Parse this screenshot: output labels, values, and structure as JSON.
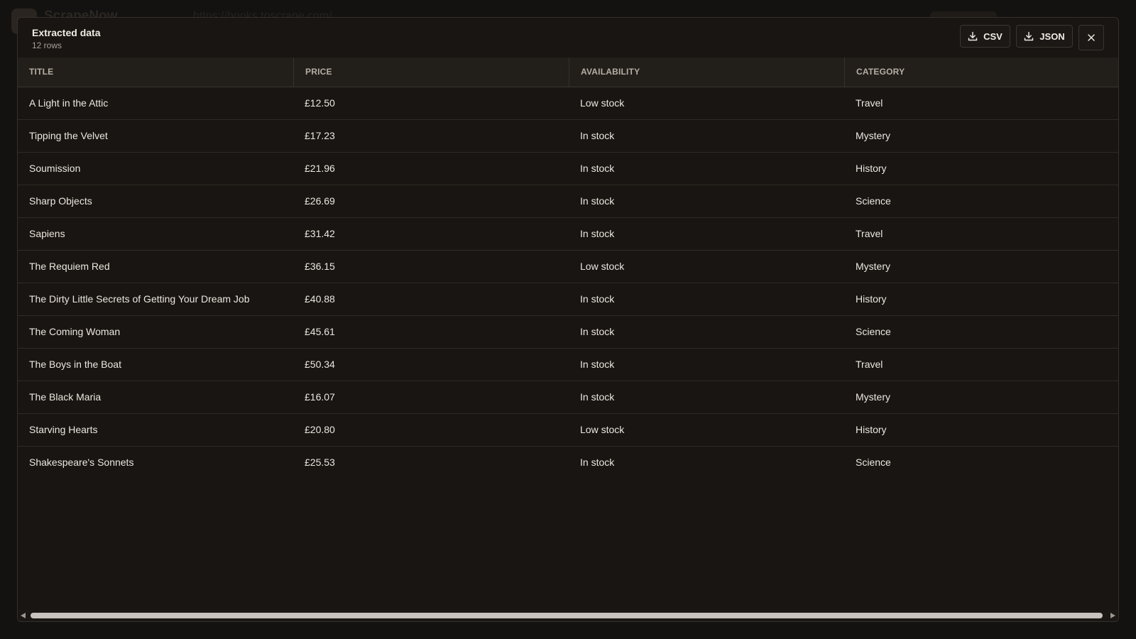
{
  "background": {
    "app_name": "ScrapeNow",
    "url": "https://books.toscrape.com/"
  },
  "modal": {
    "title": "Extracted data",
    "subtitle": "12 rows",
    "csv_label": "CSV",
    "json_label": "JSON",
    "close_icon": "close-icon",
    "download_icon": "download-icon"
  },
  "table": {
    "columns": [
      "TITLE",
      "PRICE",
      "AVAILABILITY",
      "CATEGORY"
    ],
    "rows": [
      [
        "A Light in the Attic",
        "£12.50",
        "Low stock",
        "Travel"
      ],
      [
        "Tipping the Velvet",
        "£17.23",
        "In stock",
        "Mystery"
      ],
      [
        "Soumission",
        "£21.96",
        "In stock",
        "History"
      ],
      [
        "Sharp Objects",
        "£26.69",
        "In stock",
        "Science"
      ],
      [
        "Sapiens",
        "£31.42",
        "In stock",
        "Travel"
      ],
      [
        "The Requiem Red",
        "£36.15",
        "Low stock",
        "Mystery"
      ],
      [
        "The Dirty Little Secrets of Getting Your Dream Job",
        "£40.88",
        "In stock",
        "History"
      ],
      [
        "The Coming Woman",
        "£45.61",
        "In stock",
        "Science"
      ],
      [
        "The Boys in the Boat",
        "£50.34",
        "In stock",
        "Travel"
      ],
      [
        "The Black Maria",
        "£16.07",
        "In stock",
        "Mystery"
      ],
      [
        "Starving Hearts",
        "£20.80",
        "Low stock",
        "History"
      ],
      [
        "Shakespeare's Sonnets",
        "£25.53",
        "In stock",
        "Science"
      ]
    ]
  },
  "colors": {
    "background": "#141210",
    "modal": "#181512",
    "header_row": "#221f1b",
    "text": "#ece7df",
    "muted": "#a8a097"
  }
}
